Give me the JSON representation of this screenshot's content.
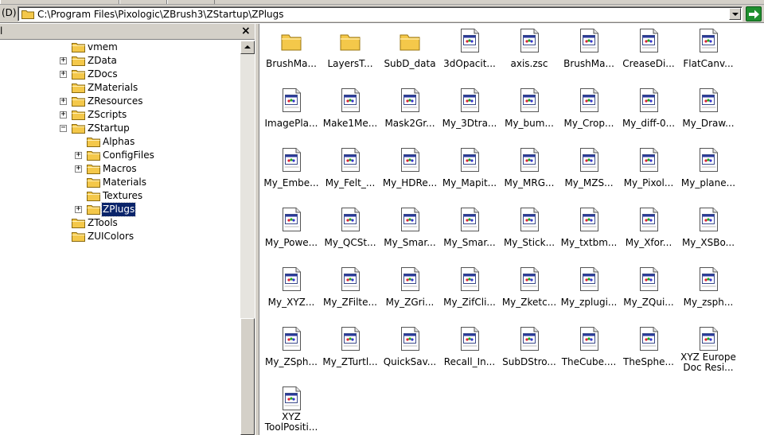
{
  "address_bar": {
    "label": "(D)",
    "path": "C:\\Program Files\\Pixologic\\ZBrush3\\ZStartup\\ZPlugs"
  },
  "folder_pane": {
    "header_label": "l",
    "close_glyph": "×",
    "tree": [
      {
        "label": "vmem",
        "expander": ""
      },
      {
        "label": "ZData",
        "expander": "+"
      },
      {
        "label": "ZDocs",
        "expander": "+"
      },
      {
        "label": "ZMaterials",
        "expander": ""
      },
      {
        "label": "ZResources",
        "expander": "+"
      },
      {
        "label": "ZScripts",
        "expander": "+"
      },
      {
        "label": "ZStartup",
        "expander": "−"
      },
      {
        "label": "Alphas",
        "expander": ""
      },
      {
        "label": "ConfigFiles",
        "expander": "+"
      },
      {
        "label": "Macros",
        "expander": "+"
      },
      {
        "label": "Materials",
        "expander": ""
      },
      {
        "label": "Textures",
        "expander": ""
      },
      {
        "label": "ZPlugs",
        "expander": "+",
        "selected": true
      },
      {
        "label": "ZTools",
        "expander": ""
      },
      {
        "label": "ZUIColors",
        "expander": ""
      }
    ]
  },
  "files": [
    {
      "label": "BrushMa...",
      "icon": "folder-icon"
    },
    {
      "label": "LayersT...",
      "icon": "folder-icon"
    },
    {
      "label": "SubD_data",
      "icon": "folder-icon"
    },
    {
      "label": "3dOpacit...",
      "icon": "zsc-file-icon"
    },
    {
      "label": "axis.zsc",
      "icon": "zsc-file-icon"
    },
    {
      "label": "BrushMa...",
      "icon": "zsc-file-icon"
    },
    {
      "label": "CreaseDi...",
      "icon": "zsc-file-icon"
    },
    {
      "label": "FlatCanv...",
      "icon": "zsc-file-icon"
    },
    {
      "label": "ImagePla...",
      "icon": "zsc-file-icon"
    },
    {
      "label": "Make1Me...",
      "icon": "zsc-file-icon"
    },
    {
      "label": "Mask2Gr...",
      "icon": "zsc-file-icon"
    },
    {
      "label": "My_3Dtra...",
      "icon": "zsc-file-icon"
    },
    {
      "label": "My_bum...",
      "icon": "zsc-file-icon"
    },
    {
      "label": "My_Crop...",
      "icon": "zsc-file-icon"
    },
    {
      "label": "My_diff-0...",
      "icon": "zsc-file-icon"
    },
    {
      "label": "My_Draw...",
      "icon": "zsc-file-icon"
    },
    {
      "label": "My_Embe...",
      "icon": "zsc-file-icon"
    },
    {
      "label": "My_Felt_...",
      "icon": "zsc-file-icon"
    },
    {
      "label": "My_HDRe...",
      "icon": "zsc-file-icon"
    },
    {
      "label": "My_Mapit...",
      "icon": "zsc-file-icon"
    },
    {
      "label": "My_MRG...",
      "icon": "zsc-file-icon"
    },
    {
      "label": "My_MZS...",
      "icon": "zsc-file-icon"
    },
    {
      "label": "My_Pixol...",
      "icon": "zsc-file-icon"
    },
    {
      "label": "My_plane...",
      "icon": "zsc-file-icon"
    },
    {
      "label": "My_Powe...",
      "icon": "zsc-file-icon"
    },
    {
      "label": "My_QCSt...",
      "icon": "zsc-file-icon"
    },
    {
      "label": "My_Smar...",
      "icon": "zsc-file-icon"
    },
    {
      "label": "My_Smar...",
      "icon": "zsc-file-icon"
    },
    {
      "label": "My_Stick...",
      "icon": "zsc-file-icon"
    },
    {
      "label": "My_txtbm...",
      "icon": "zsc-file-icon"
    },
    {
      "label": "My_Xfor...",
      "icon": "zsc-file-icon"
    },
    {
      "label": "My_XSBo...",
      "icon": "zsc-file-icon"
    },
    {
      "label": "My_XYZ...",
      "icon": "zsc-file-icon"
    },
    {
      "label": "My_ZFilte...",
      "icon": "zsc-file-icon"
    },
    {
      "label": "My_ZGri...",
      "icon": "zsc-file-icon"
    },
    {
      "label": "My_ZifCli...",
      "icon": "zsc-file-icon"
    },
    {
      "label": "My_Zketc...",
      "icon": "zsc-file-icon"
    },
    {
      "label": "My_zplugi...",
      "icon": "zsc-file-icon"
    },
    {
      "label": "My_ZQui...",
      "icon": "zsc-file-icon"
    },
    {
      "label": "My_zsph...",
      "icon": "zsc-file-icon"
    },
    {
      "label": "My_ZSph...",
      "icon": "zsc-file-icon"
    },
    {
      "label": "My_ZTurtl...",
      "icon": "zsc-file-icon"
    },
    {
      "label": "QuickSav...",
      "icon": "zsc-file-icon"
    },
    {
      "label": "Recall_In...",
      "icon": "zsc-file-icon"
    },
    {
      "label": "SubDStro...",
      "icon": "zsc-file-icon"
    },
    {
      "label": "TheCube....",
      "icon": "zsc-file-icon"
    },
    {
      "label": "TheSphe...",
      "icon": "zsc-file-icon"
    },
    {
      "label": "XYZ Europe\nDoc Resi...",
      "icon": "zsc-file-icon"
    },
    {
      "label": "XYZ\nToolPositi...",
      "icon": "zsc-file-icon"
    }
  ],
  "colors": {
    "selection": "#0a246a",
    "folder": "#f4c84a",
    "chrome": "#d4d0c8",
    "go_button": "#1f8f2e"
  }
}
